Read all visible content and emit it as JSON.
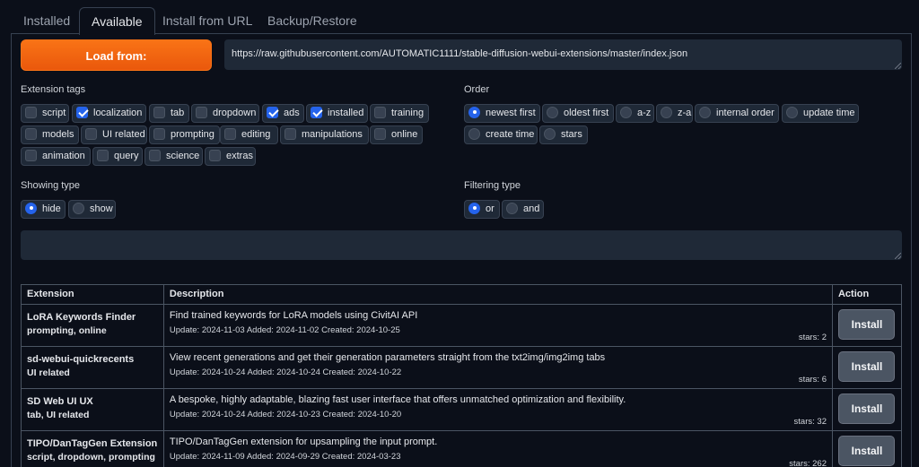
{
  "tabs": [
    "Installed",
    "Available",
    "Install from URL",
    "Backup/Restore"
  ],
  "load_button": "Load from:",
  "url": "https://raw.githubusercontent.com/AUTOMATIC1111/stable-diffusion-webui-extensions/master/index.json",
  "extension_tags": {
    "label": "Extension tags",
    "items": [
      {
        "label": "script",
        "checked": false
      },
      {
        "label": "localization",
        "checked": true
      },
      {
        "label": "tab",
        "checked": false
      },
      {
        "label": "dropdown",
        "checked": false
      },
      {
        "label": "ads",
        "checked": true
      },
      {
        "label": "installed",
        "checked": true
      },
      {
        "label": "training",
        "checked": false
      },
      {
        "label": "models",
        "checked": false
      },
      {
        "label": "UI related",
        "checked": false
      },
      {
        "label": "prompting",
        "checked": false
      },
      {
        "label": "editing",
        "checked": false
      },
      {
        "label": "manipulations",
        "checked": false
      },
      {
        "label": "online",
        "checked": false
      },
      {
        "label": "animation",
        "checked": false
      },
      {
        "label": "query",
        "checked": false
      },
      {
        "label": "science",
        "checked": false
      },
      {
        "label": "extras",
        "checked": false
      }
    ]
  },
  "order": {
    "label": "Order",
    "items": [
      {
        "label": "newest first",
        "checked": true
      },
      {
        "label": "oldest first",
        "checked": false
      },
      {
        "label": "a-z",
        "checked": false
      },
      {
        "label": "z-a",
        "checked": false
      },
      {
        "label": "internal order",
        "checked": false
      },
      {
        "label": "update time",
        "checked": false
      },
      {
        "label": "create time",
        "checked": false
      },
      {
        "label": "stars",
        "checked": false
      }
    ]
  },
  "showing_type": {
    "label": "Showing type",
    "items": [
      {
        "label": "hide",
        "checked": true
      },
      {
        "label": "show",
        "checked": false
      }
    ]
  },
  "filtering_type": {
    "label": "Filtering type",
    "items": [
      {
        "label": "or",
        "checked": true
      },
      {
        "label": "and",
        "checked": false
      }
    ]
  },
  "search_value": "",
  "table": {
    "headers": [
      "Extension",
      "Description",
      "Action"
    ],
    "rows": [
      {
        "name": "LoRA Keywords Finder",
        "tags": "prompting, online",
        "description": "Find trained keywords for LoRA models using CivitAI API",
        "meta": "Update: 2024-11-03 Added: 2024-11-02 Created: 2024-10-25",
        "stars": "stars: 2",
        "action": "Install"
      },
      {
        "name": "sd-webui-quickrecents",
        "tags": "UI related",
        "description": "View recent generations and get their generation parameters straight from the txt2img/img2img tabs",
        "meta": "Update: 2024-10-24 Added: 2024-10-24 Created: 2024-10-22",
        "stars": "stars: 6",
        "action": "Install"
      },
      {
        "name": "SD Web UI UX",
        "tags": "tab, UI related",
        "description": "A bespoke, highly adaptable, blazing fast user interface that offers unmatched optimization and flexibility.",
        "meta": "Update: 2024-10-24 Added: 2024-10-23 Created: 2024-10-20",
        "stars": "stars: 32",
        "action": "Install"
      },
      {
        "name": "TIPO/DanTagGen Extension",
        "tags": "script, dropdown, prompting",
        "description": "TIPO/DanTagGen extension for upsampling the input prompt.",
        "meta": "Update: 2024-11-09 Added: 2024-09-29 Created: 2024-03-23",
        "stars": "stars: 262",
        "action": "Install"
      }
    ]
  },
  "colors": {
    "accent": "#f97316",
    "checked": "#2563eb",
    "background": "#0b0f19",
    "input": "#1f2937"
  }
}
